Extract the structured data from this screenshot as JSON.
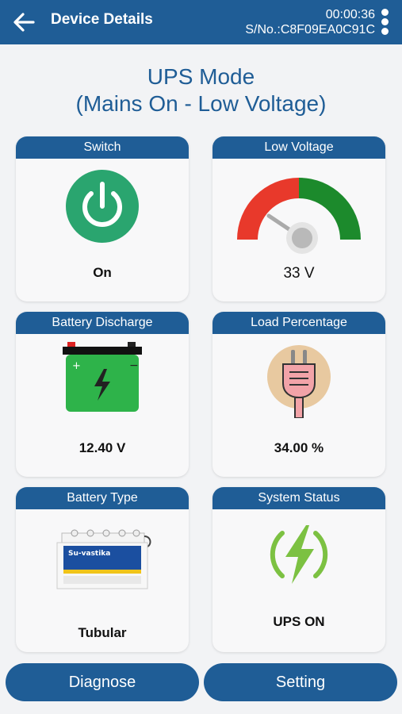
{
  "header": {
    "title": "Device Details",
    "time": "00:00:36",
    "serial": "S/No.:C8F09EA0C91C"
  },
  "mode": {
    "line1": "UPS Mode",
    "line2": "(Mains On - Low Voltage)"
  },
  "cards": {
    "switch": {
      "title": "Switch",
      "value": "On",
      "icon": "power-icon"
    },
    "voltage": {
      "title": "Low Voltage",
      "value": "33 V",
      "icon": "gauge-icon"
    },
    "battery_discharge": {
      "title": "Battery Discharge",
      "value": "12.40 V",
      "icon": "battery-icon"
    },
    "load": {
      "title": "Load Percentage",
      "value": "34.00 %",
      "icon": "plug-icon"
    },
    "battery_type": {
      "title": "Battery Type",
      "value": "Tubular",
      "icon": "battery-product-icon",
      "brand": "Su-vastika"
    },
    "system_status": {
      "title": "System Status",
      "value": "UPS ON",
      "icon": "lightning-icon"
    }
  },
  "buttons": {
    "diagnose": "Diagnose",
    "setting": "Setting"
  },
  "colors": {
    "header": "#1f5d96",
    "power_green": "#2aa56f",
    "gauge_red": "#e8392b",
    "gauge_green": "#1c8a2c",
    "battery_green": "#2eb34a",
    "lightning_green": "#7cc142",
    "plug_bg": "#e8c9a0"
  }
}
